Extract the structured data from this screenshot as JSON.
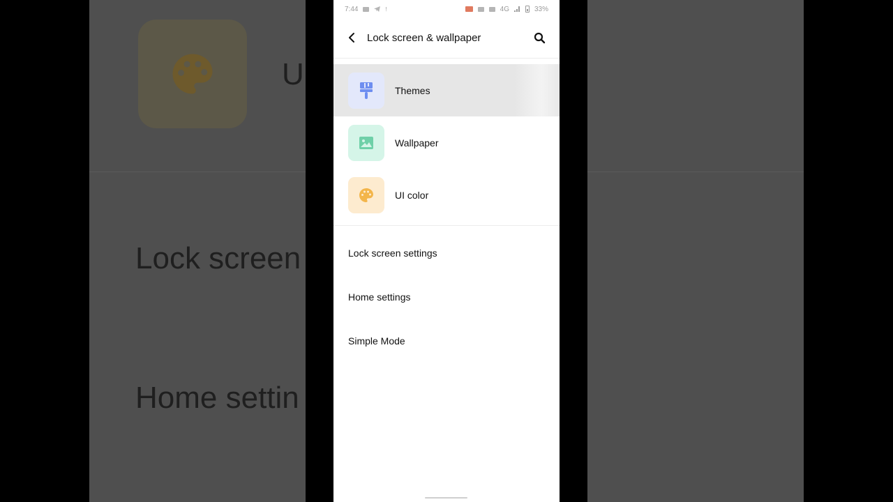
{
  "background": {
    "text_1": "U",
    "text_2": "Lock screen",
    "text_3": "Home settin"
  },
  "status_bar": {
    "time": "7:44",
    "network": "4G",
    "battery": "33%"
  },
  "app_bar": {
    "title": "Lock screen & wallpaper"
  },
  "icon_items": [
    {
      "label": "Themes",
      "icon": "paintbrush-icon",
      "tile_color": "#e3e8fb",
      "icon_color": "#6e8ef0"
    },
    {
      "label": "Wallpaper",
      "icon": "image-icon",
      "tile_color": "#d5f5e8",
      "icon_color": "#6fd0a8"
    },
    {
      "label": "UI color",
      "icon": "palette-icon",
      "tile_color": "#fdebcf",
      "icon_color": "#f3b54a"
    }
  ],
  "text_items": [
    {
      "label": "Lock screen settings"
    },
    {
      "label": "Home settings"
    },
    {
      "label": "Simple Mode"
    }
  ]
}
